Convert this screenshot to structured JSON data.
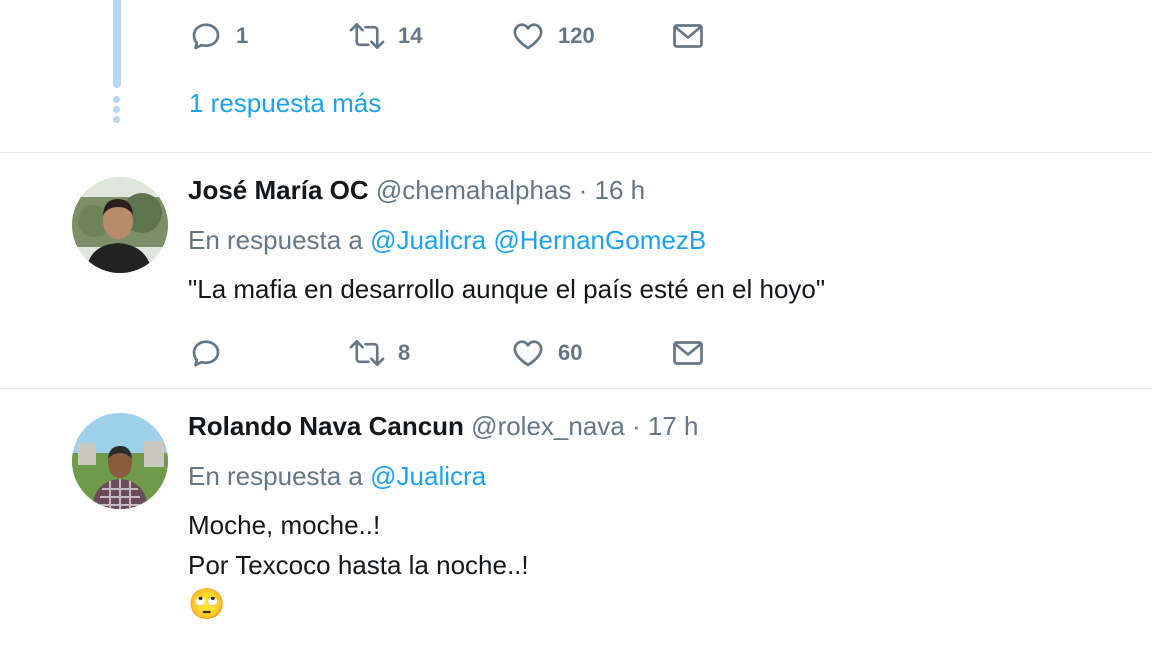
{
  "top_tweet": {
    "actions": {
      "reply_count": "1",
      "retweet_count": "14",
      "like_count": "120"
    },
    "more_replies_label": "1 respuesta más"
  },
  "tweets": [
    {
      "name": "José María OC",
      "handle": "@chemahalphas",
      "separator": "·",
      "time": "16 h",
      "reply_prefix": "En respuesta a",
      "reply_to": [
        "@Jualicra",
        "@HernanGomezB"
      ],
      "text": [
        "\"La mafia en desarrollo aunque el país esté en el hoyo\""
      ],
      "actions": {
        "reply_count": "",
        "retweet_count": "8",
        "like_count": "60"
      }
    },
    {
      "name": "Rolando Nava Cancun",
      "handle": "@rolex_nava",
      "separator": "·",
      "time": "17 h",
      "reply_prefix": "En respuesta a",
      "reply_to": [
        "@Jualicra"
      ],
      "text": [
        "Moche, moche..!",
        "Por Texcoco hasta la noche..!"
      ],
      "emoji": "🙄"
    }
  ],
  "icons": {
    "reply": "reply-icon",
    "retweet": "retweet-icon",
    "like": "heart-icon",
    "message": "mail-icon"
  },
  "colors": {
    "link": "#1da1f2",
    "secondary_text": "#657786",
    "thread_line": "#b3d9f2",
    "divider": "#e1e8ed"
  }
}
